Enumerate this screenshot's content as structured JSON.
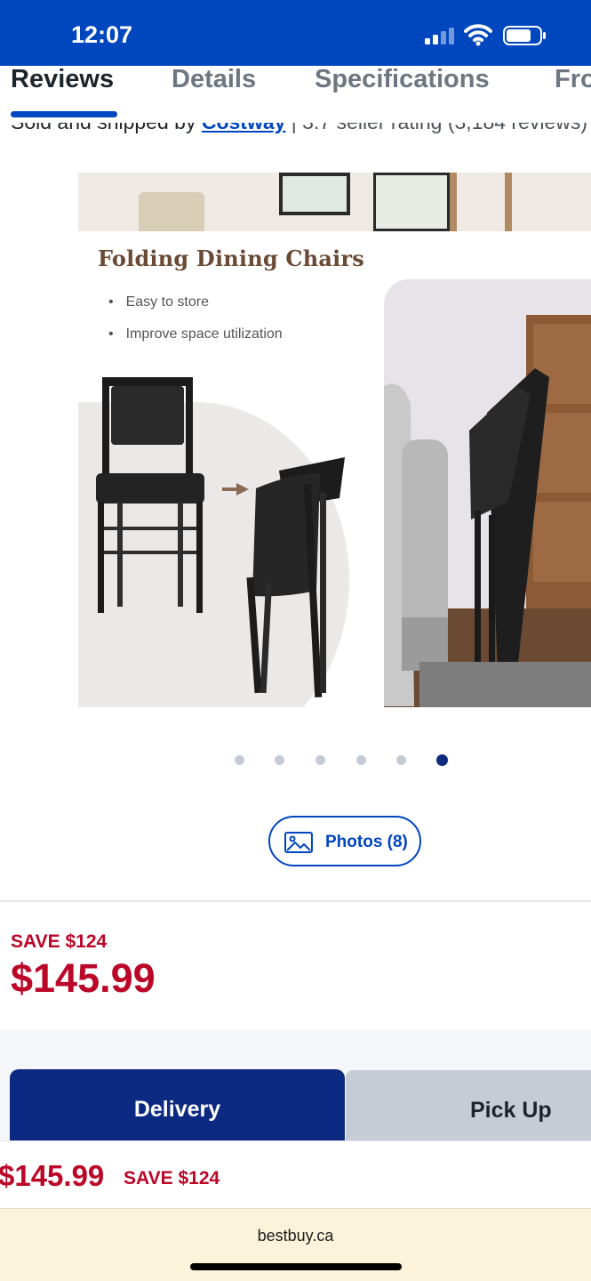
{
  "status_bar": {
    "time": "12:07",
    "signal_icon": "cellular-signal-icon",
    "wifi_icon": "wifi-icon",
    "battery_icon": "battery-icon",
    "background_color": "#0046be"
  },
  "tabs": [
    {
      "label": "Reviews",
      "active": true
    },
    {
      "label": "Details",
      "active": false
    },
    {
      "label": "Specifications",
      "active": false
    },
    {
      "label": "Fro",
      "active": false
    }
  ],
  "seller": {
    "prefix": "Sold and shipped by ",
    "name": "Costway",
    "rating_text": " | 3.7 seller rating (3,184 reviews)"
  },
  "product_image": {
    "title": "Folding Dining Chairs",
    "bullets": [
      "Easy to store",
      "Improve space utilization"
    ]
  },
  "carousel": {
    "total": 6,
    "active_index": 5
  },
  "photos_button": {
    "icon": "image-icon",
    "label": "Photos (8)"
  },
  "pricing": {
    "save_label": "SAVE $124",
    "price": "$145.99"
  },
  "fulfillment": {
    "delivery_label": "Delivery",
    "pickup_label": "Pick Up",
    "selected": "Delivery"
  },
  "sticky_bar": {
    "price": "$145.99",
    "save_label": "SAVE $124"
  },
  "browser": {
    "url": "bestbuy.ca"
  },
  "colors": {
    "brand_blue": "#0046be",
    "dark_blue": "#0d2a82",
    "sale_red": "#bb0628",
    "url_bar": "#fbf4db"
  }
}
